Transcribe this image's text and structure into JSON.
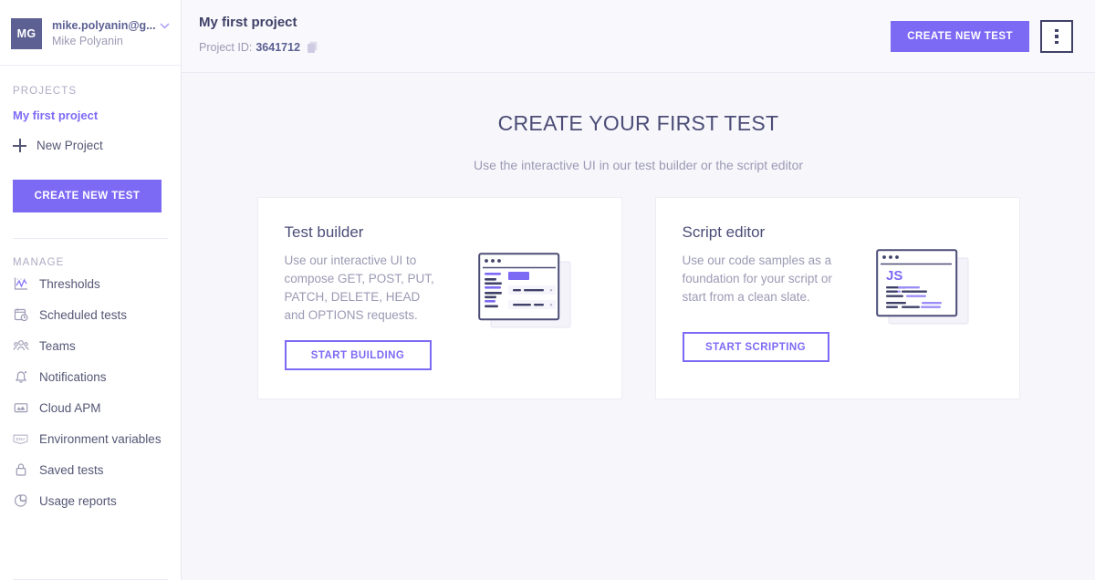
{
  "colors": {
    "accent": "#7c6af5",
    "avatar_bg": "#5c6093",
    "heading": "#4b4d77",
    "muted": "#9b9ab4",
    "page_bg": "#f7f6fb",
    "card_bg": "#ffffff"
  },
  "sidebar": {
    "account": {
      "avatar_initials": "MG",
      "email": "mike.polyanin@g...",
      "name": "Mike Polyanin",
      "chevron_icon": "chevron-down-icon"
    },
    "projects": {
      "label": "PROJECTS",
      "active_project": "My first project",
      "new_project": "New Project",
      "new_project_icon": "plus-icon"
    },
    "create_test_button": "CREATE NEW TEST",
    "manage": {
      "label": "MANAGE",
      "items": [
        {
          "label": "Thresholds",
          "icon": "chart-threshold-icon"
        },
        {
          "label": "Scheduled tests",
          "icon": "calendar-clock-icon"
        },
        {
          "label": "Teams",
          "icon": "people-group-icon"
        },
        {
          "label": "Notifications",
          "icon": "bell-icon"
        },
        {
          "label": "Cloud APM",
          "icon": "cloud-apm-chart-icon"
        },
        {
          "label": "Environment variables",
          "icon": "env-tag-icon"
        },
        {
          "label": "Saved tests",
          "icon": "lock-icon"
        },
        {
          "label": "Usage reports",
          "icon": "pie-chart-icon"
        }
      ]
    }
  },
  "header": {
    "project_title": "My first project",
    "project_id_label": "Project ID:",
    "project_id_value": "3641712",
    "copy_icon": "copy-icon",
    "create_test_button": "CREATE NEW TEST",
    "kebab_icon": "more-vertical-icon"
  },
  "main": {
    "hero_title": "CREATE YOUR FIRST TEST",
    "hero_subtitle": "Use the interactive UI in our test builder or the script editor",
    "cards": [
      {
        "title": "Test builder",
        "description": "Use our interactive UI to compose GET, POST, PUT, PATCH, DELETE, HEAD and OPTIONS requests.",
        "button": "START BUILDING",
        "illustration": "browser-window-form-illustration"
      },
      {
        "title": "Script editor",
        "description": "Use our code samples as a foundation for your script or start from a clean slate.",
        "button": "START SCRIPTING",
        "illustration": "browser-window-js-code-illustration",
        "illustration_label": "JS"
      }
    ]
  }
}
